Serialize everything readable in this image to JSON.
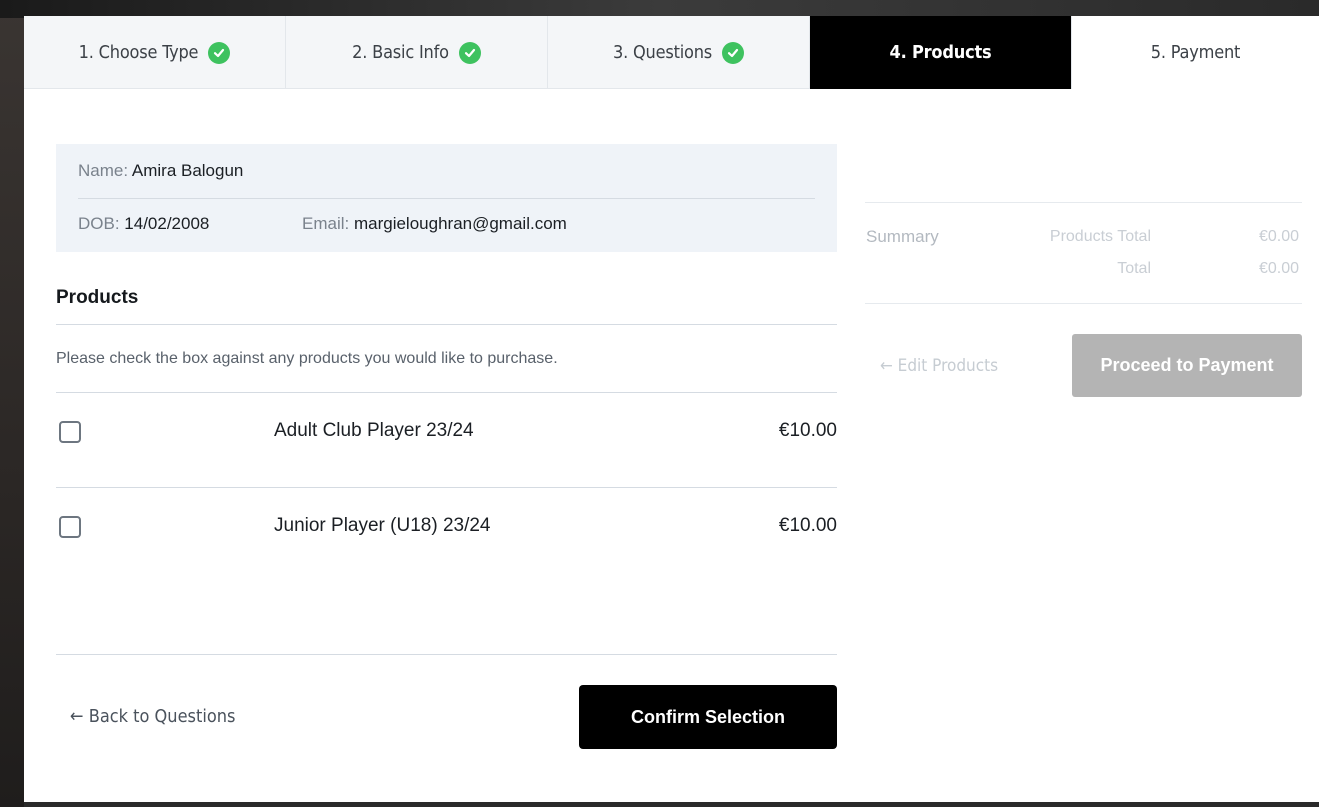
{
  "steps": [
    {
      "label": "1. Choose Type",
      "done": true
    },
    {
      "label": "2. Basic Info",
      "done": true
    },
    {
      "label": "3. Questions",
      "done": true
    },
    {
      "label": "4. Products",
      "done": false,
      "active": true
    },
    {
      "label": "5. Payment",
      "done": false
    }
  ],
  "member": {
    "name_label": "Name:",
    "name": "Amira Balogun",
    "dob_label": "DOB:",
    "dob": "14/02/2008",
    "email_label": "Email:",
    "email": "margieloughran@gmail.com"
  },
  "products": {
    "title": "Products",
    "instruction": "Please check the box against any products you would like to purchase.",
    "items": [
      {
        "name": "Adult Club Player 23/24",
        "price": "€10.00",
        "checked": false
      },
      {
        "name": "Junior Player (U18) 23/24",
        "price": "€10.00",
        "checked": false
      }
    ]
  },
  "actions": {
    "back_label": "← Back to Questions",
    "confirm_label": "Confirm Selection"
  },
  "summary": {
    "label": "Summary",
    "products_total_label": "Products Total",
    "products_total": "€0.00",
    "total_label": "Total",
    "total": "€0.00",
    "edit_label": "← Edit Products",
    "proceed_label": "Proceed to Payment"
  },
  "colors": {
    "accent_active": "#000000",
    "check_green": "#3ec25f",
    "disabled_button": "#b4b4b4"
  }
}
